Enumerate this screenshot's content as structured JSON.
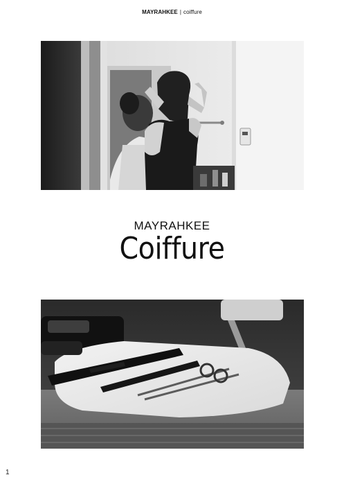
{
  "header": {
    "brand": "MAYRAHKEE",
    "separator": "|",
    "subtitle": "coiffure"
  },
  "title": {
    "main": "MAYRAHKEE",
    "sub": "Coiffure"
  },
  "photos": {
    "top": "black-and-white photo: stylist styling a client's hair in a salon",
    "bottom": "black-and-white photo: combs and scissors laid on a towel"
  },
  "page_number": "1"
}
